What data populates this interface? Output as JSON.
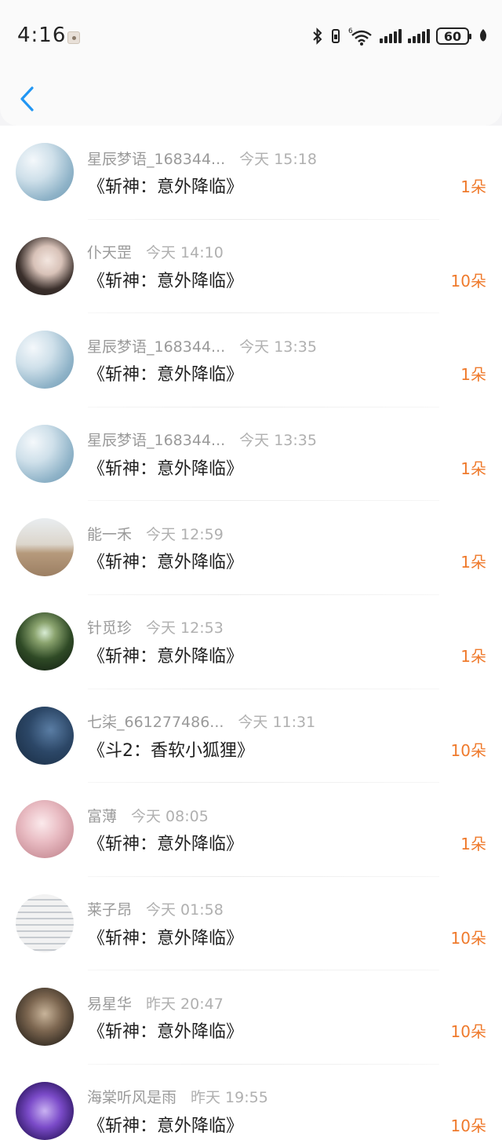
{
  "status_bar": {
    "time": "4:16",
    "battery": "60",
    "icons": [
      "notification-icon",
      "bluetooth-icon",
      "vibrate-icon",
      "wifi-6-icon",
      "signal-icon",
      "signal-icon",
      "battery-icon",
      "leaf-icon"
    ]
  },
  "nav": {
    "back_icon": "chevron-left-icon"
  },
  "colors": {
    "accent": "#2196f3",
    "amount": "#ef7a2c",
    "meta": "#9a9a9a"
  },
  "rows": [
    {
      "name": "星辰梦语_168344...",
      "time": "今天 15:18",
      "book": "《斩神：意外降临》",
      "amount": "1朵",
      "avatar": "misty-landscape"
    },
    {
      "name": "仆天罡",
      "time": "今天 14:10",
      "book": "《斩神：意外降临》",
      "amount": "10朵",
      "avatar": "girl-portrait"
    },
    {
      "name": "星辰梦语_168344...",
      "time": "今天 13:35",
      "book": "《斩神：意外降临》",
      "amount": "1朵",
      "avatar": "misty-landscape"
    },
    {
      "name": "星辰梦语_168344...",
      "time": "今天 13:35",
      "book": "《斩神：意外降临》",
      "amount": "1朵",
      "avatar": "misty-landscape"
    },
    {
      "name": "能一禾",
      "time": "今天 12:59",
      "book": "《斩神：意外降临》",
      "amount": "1朵",
      "avatar": "child-outdoor"
    },
    {
      "name": "针觅珍",
      "time": "今天 12:53",
      "book": "《斩神：意外降临》",
      "amount": "1朵",
      "avatar": "night-field"
    },
    {
      "name": "七柒_661277486...",
      "time": "今天 11:31",
      "book": "《斗2：香软小狐狸》",
      "amount": "10朵",
      "avatar": "night-figure"
    },
    {
      "name": "富薄",
      "time": "今天 08:05",
      "book": "《斩神：意外降临》",
      "amount": "1朵",
      "avatar": "pink-illustration"
    },
    {
      "name": "莱子昂",
      "time": "今天 01:58",
      "book": "《斩神：意外降临》",
      "amount": "10朵",
      "avatar": "handwriting"
    },
    {
      "name": "易星华",
      "time": "昨天 20:47",
      "book": "《斩神：意外降临》",
      "amount": "10朵",
      "avatar": "two-kids"
    },
    {
      "name": "海棠听风是雨",
      "time": "昨天 19:55",
      "book": "《斩神：意外降临》",
      "amount": "10朵",
      "avatar": "purple-crowd"
    }
  ]
}
